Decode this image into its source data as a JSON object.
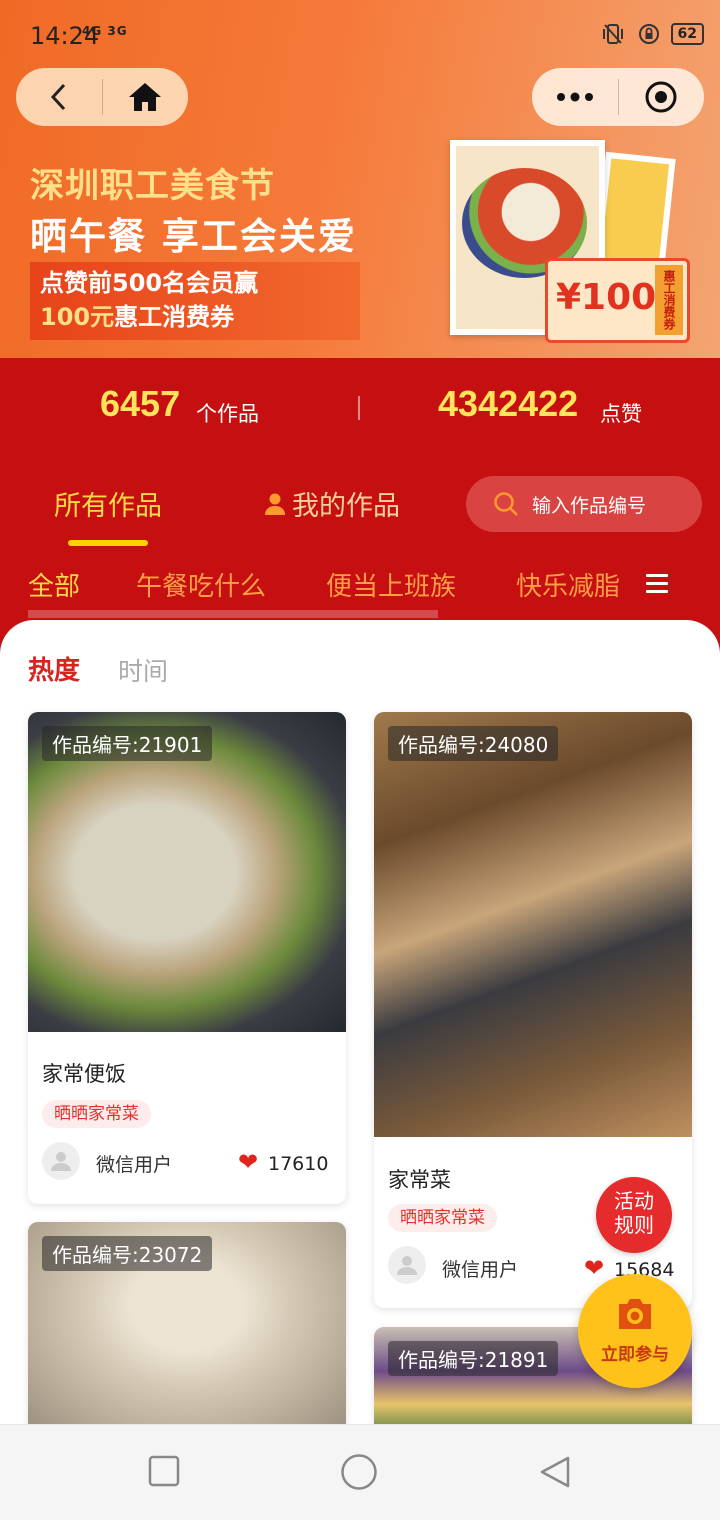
{
  "status": {
    "time": "14:24",
    "net": "4G 3G",
    "battery": "62"
  },
  "banner": {
    "title1": "深圳职工美食节",
    "title2": "晒午餐   享工会关爱",
    "promo_line1": "点赞前500名会员赢",
    "promo_amount": "100元",
    "promo_line2": "惠工消费券",
    "coupon_amount": "¥100",
    "coupon_tag": "惠工消费券"
  },
  "stats": {
    "works_count": "6457",
    "works_unit": "个作品",
    "likes_count": "4342422",
    "likes_unit": "点赞"
  },
  "tabs": {
    "all": "所有作品",
    "mine": "我的作品",
    "search_placeholder": "输入作品编号"
  },
  "categories": [
    "全部",
    "午餐吃什么",
    "便当上班族",
    "快乐减脂"
  ],
  "sort": {
    "hot": "热度",
    "time": "时间"
  },
  "cards": [
    {
      "id_label": "作品编号:21901",
      "title": "家常便饭",
      "tag": "晒晒家常菜",
      "user": "微信用户",
      "likes": "17610"
    },
    {
      "id_label": "作品编号:24080",
      "title": "家常菜",
      "tag": "晒晒家常菜",
      "user": "微信用户",
      "likes": "15684"
    },
    {
      "id_label": "作品编号:23072"
    },
    {
      "id_label": "作品编号:21891"
    }
  ],
  "fab": {
    "rules_line1": "活动",
    "rules_line2": "规则",
    "join": "立即参与"
  },
  "colors": {
    "primary_red": "#c50f10",
    "accent_yellow": "#ffd84a",
    "orange": "#f06a25"
  }
}
